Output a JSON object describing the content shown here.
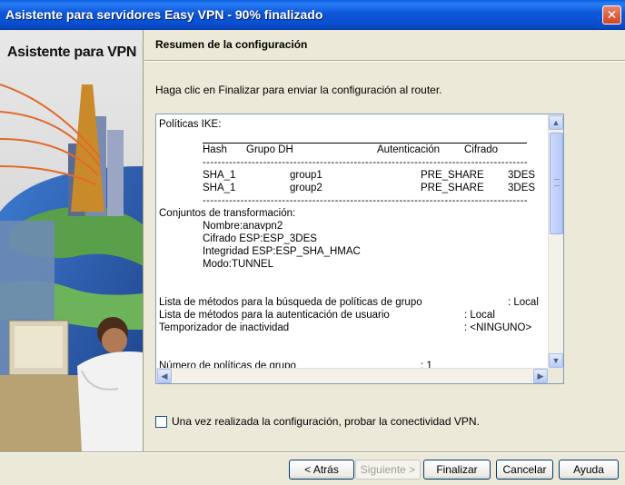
{
  "window": {
    "title": "Asistente para servidores Easy VPN - 90% finalizado",
    "close_glyph": "✕"
  },
  "art": {
    "title": "Asistente para VPN"
  },
  "content": {
    "section_title": "Resumen de la configuración",
    "instruction": "Haga clic en Finalizar para enviar la configuración al router."
  },
  "summary": {
    "ike_heading": "Políticas IKE:",
    "ike_columns": [
      "Hash",
      "Grupo DH",
      "Autenticación",
      "Cifrado"
    ],
    "ike_dashes": "-----------------------------------------------------------------------------------------------",
    "ike_rows": [
      {
        "hash": "SHA_1",
        "group": "group1",
        "auth": "PRE_SHARE",
        "cipher": "3DES"
      },
      {
        "hash": "SHA_1",
        "group": "group2",
        "auth": "PRE_SHARE",
        "cipher": "3DES"
      }
    ],
    "transform_heading": "Conjuntos de transformación:",
    "transform_lines": [
      "Nombre:anavpn2",
      "Cifrado ESP:ESP_3DES",
      "Integridad ESP:ESP_SHA_HMAC",
      "Modo:TUNNEL"
    ],
    "settings": [
      {
        "label": "Lista de métodos para la búsqueda de políticas de grupo",
        "value": ": Local"
      },
      {
        "label": "Lista de métodos para la autenticación de usuario",
        "value": ": Local"
      },
      {
        "label": "Temporizador de inactividad",
        "value": ": <NINGUNO>"
      }
    ],
    "group_count": {
      "label": "Número de políticas de grupo",
      "value": ": 1"
    }
  },
  "scroll": {
    "up": "▲",
    "down": "▼",
    "left": "◀",
    "right": "▶"
  },
  "checkbox": {
    "label": "Una vez realizada la configuración, probar la conectividad VPN.",
    "checked": false
  },
  "buttons": {
    "back": "< Atrás",
    "next": "Siguiente >",
    "finish": "Finalizar",
    "cancel": "Cancelar",
    "help": "Ayuda"
  }
}
